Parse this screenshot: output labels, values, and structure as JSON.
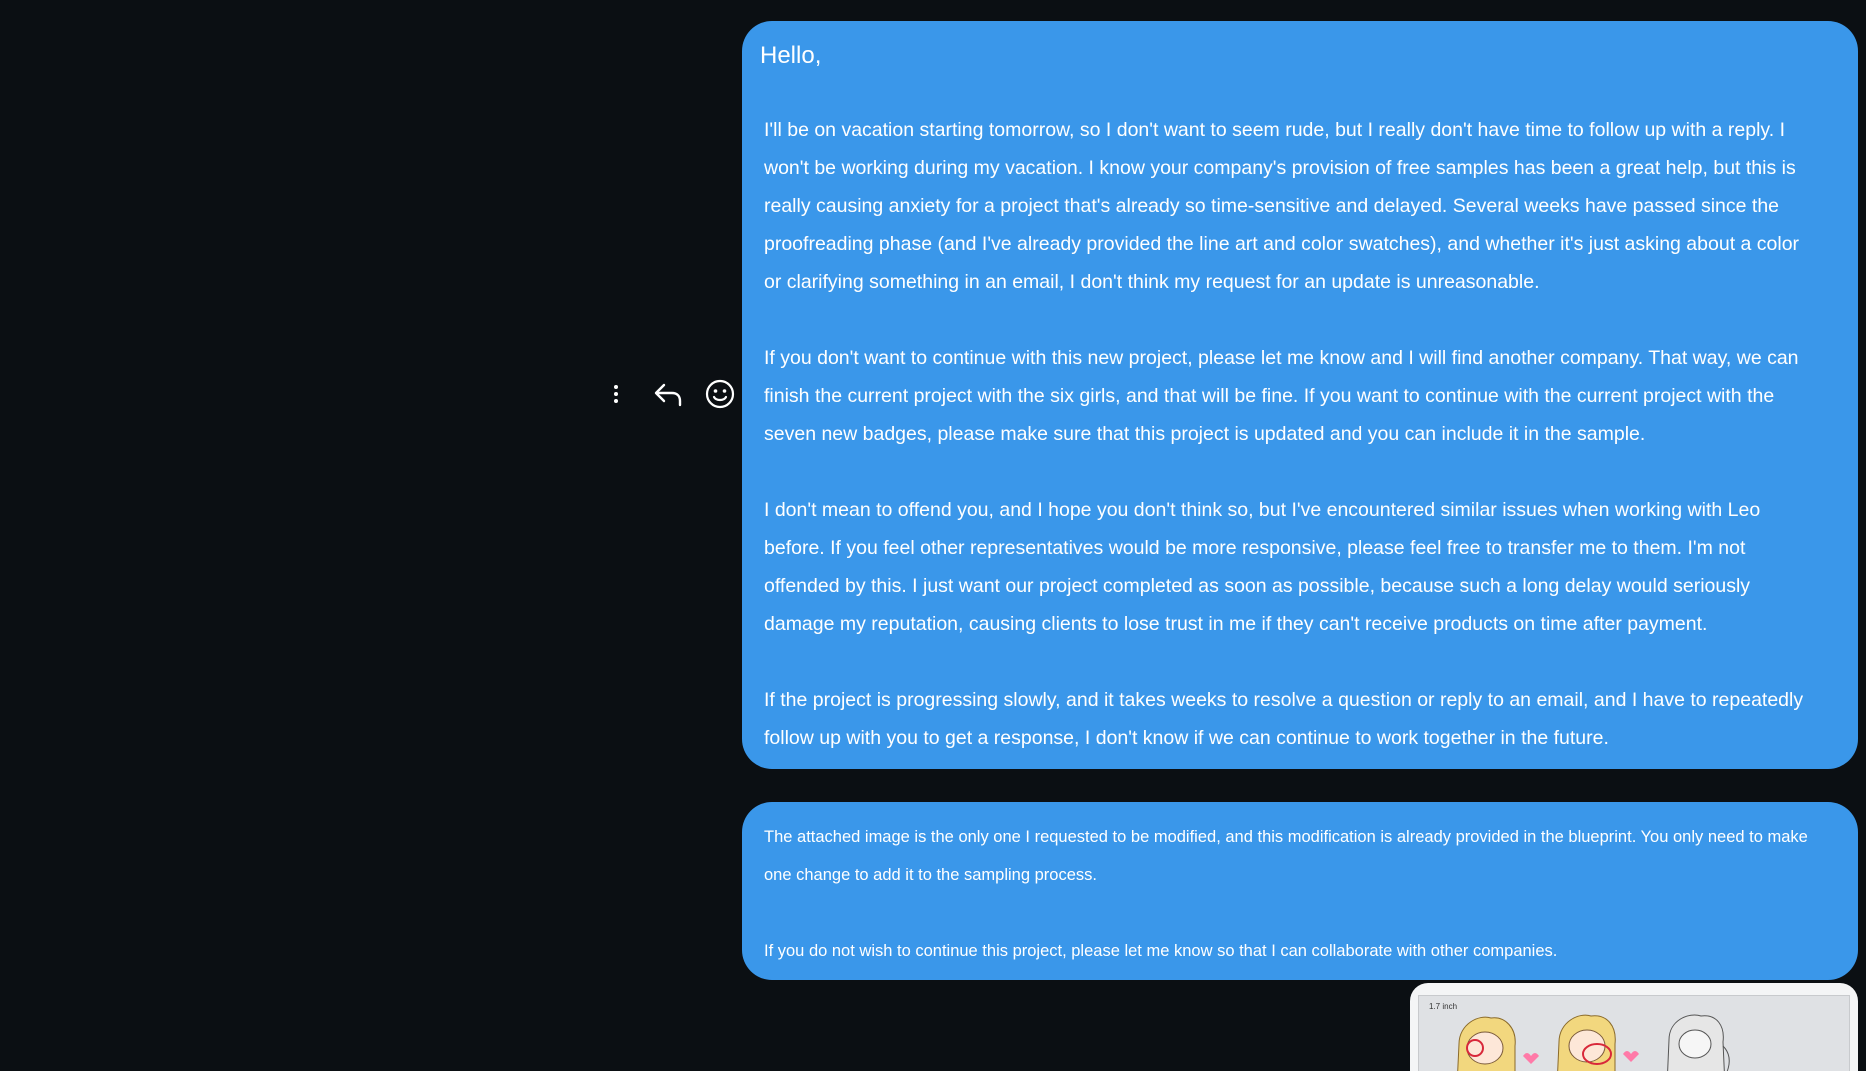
{
  "actions": {
    "more_icon": "more-vertical-icon",
    "reply_icon": "reply-icon",
    "react_icon": "emoji-icon"
  },
  "message_1": {
    "greeting": "Hello,",
    "paragraphs": [
      "I'll be on vacation starting tomorrow, so I don't want to seem rude, but I really don't have time to follow up with a reply. I won't be working during my vacation. I know your company's provision of free samples has been a great help, but this is really causing anxiety for a project that's already so time-sensitive and delayed. Several weeks have passed since the proofreading phase (and I've already provided the line art and color swatches), and whether it's just asking about a color or clarifying something in an email, I don't think my request for an update is unreasonable.",
      "If you don't want to continue with this new project, please let me know and I will find another company. That way, we can finish the current project with the six girls, and that will be fine. If you want to continue with the current project with the seven new badges, please make sure that this project is updated and you can include it in the sample.",
      "I don't mean to offend you, and I hope you don't think so, but I've encountered similar issues when working with Leo before. If you feel other representatives would be more responsive, please feel free to transfer me to them. I'm not offended by this. I just want our project completed as soon as possible, because such a long delay would seriously damage my reputation, causing clients to lose trust in me if they can't receive products on time after payment.",
      "If the project is progressing slowly, and it takes weeks to resolve a question or reply to an email, and I have to repeatedly follow up with you to get a response, I don't know if we can continue to work together in the future."
    ]
  },
  "message_2": {
    "paragraphs": [
      "The attached image is the only one I requested to be modified, and this modification is already provided in the blueprint. You only need to make one change to add it to the sampling process.",
      "If you do not wish to continue this project, please let me know so that I can collaborate with other companies."
    ]
  },
  "attachment": {
    "dimension_label": "1.7 inch"
  },
  "colors": {
    "background": "#0b0f13",
    "bubble": "#3a97ea",
    "text": "#ffffff"
  }
}
